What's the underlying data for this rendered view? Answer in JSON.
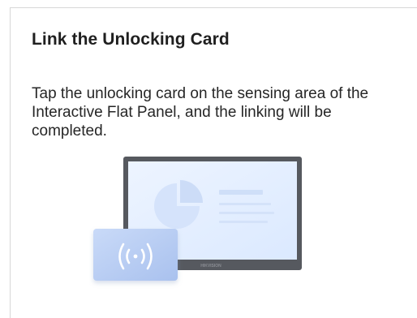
{
  "dialog": {
    "title": "Link the Unlocking Card",
    "description": "Tap the unlocking card on the sensing area of the Interactive Flat Panel, and the linking will be completed."
  },
  "illustration": {
    "panel_brand": "HIKVISION",
    "nfc_symbol": "((·))",
    "icons": [
      "flat-panel-icon",
      "unlocking-card-icon",
      "nfc-wave-icon"
    ],
    "colors": {
      "panel_frame": "#56595f",
      "panel_screen": "#e3efff",
      "card": "#bcd0f5",
      "wave": "#ffffff"
    }
  }
}
